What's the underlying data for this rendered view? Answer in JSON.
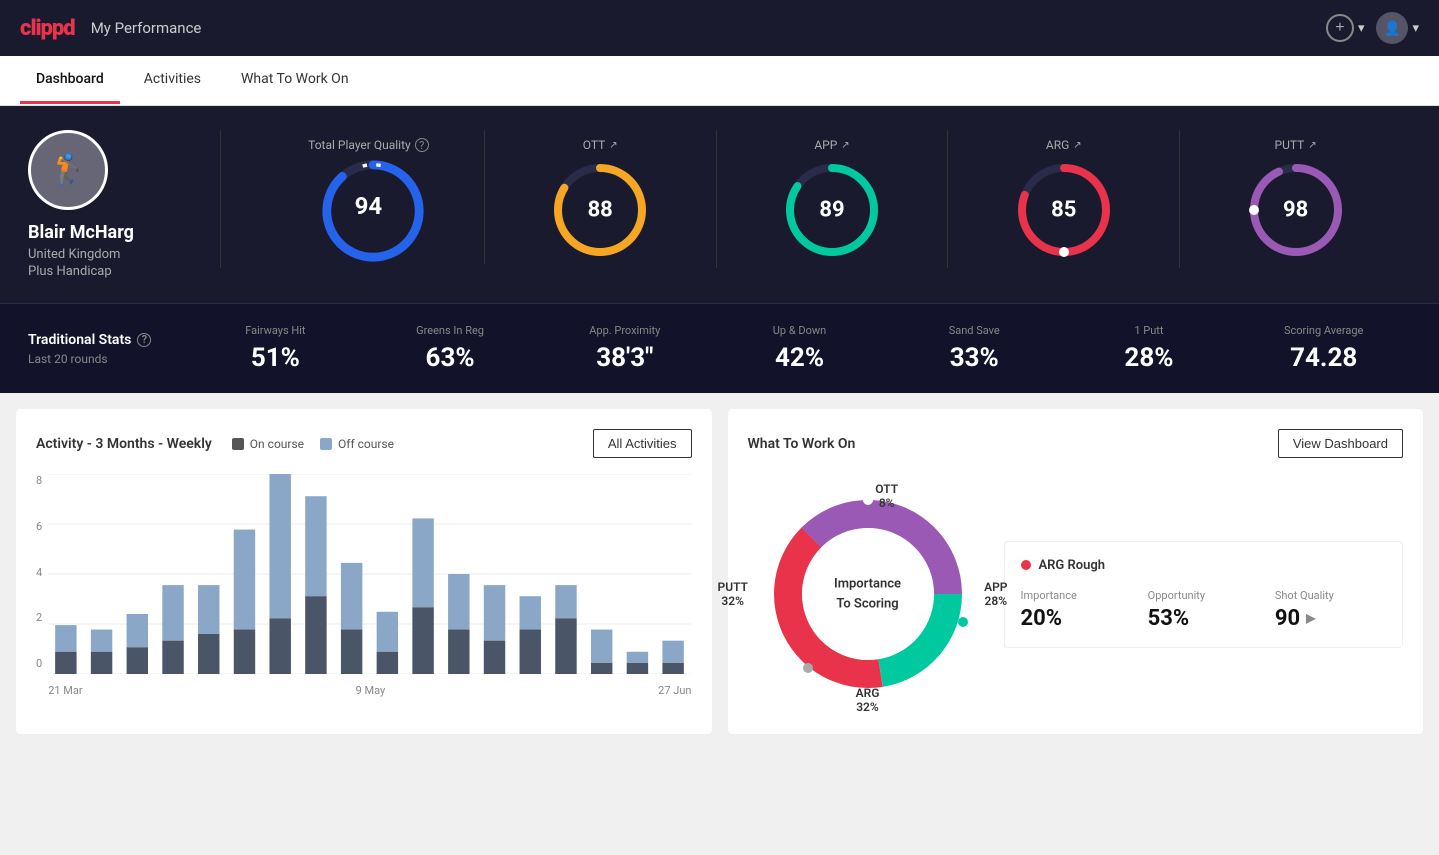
{
  "header": {
    "logo": "clippd",
    "title": "My Performance",
    "add_label": "+",
    "add_chevron": "▾",
    "avatar_text": "👤",
    "user_chevron": "▾"
  },
  "tabs": [
    {
      "id": "dashboard",
      "label": "Dashboard",
      "active": true
    },
    {
      "id": "activities",
      "label": "Activities",
      "active": false
    },
    {
      "id": "what-to-work-on",
      "label": "What To Work On",
      "active": false
    }
  ],
  "player": {
    "name": "Blair McHarg",
    "country": "United Kingdom",
    "handicap": "Plus Handicap"
  },
  "total_quality": {
    "label": "Total Player Quality",
    "value": "94",
    "color": "#2563eb"
  },
  "scores": [
    {
      "label": "OTT",
      "value": "88",
      "color": "#f5a623",
      "pct": 88
    },
    {
      "label": "APP",
      "value": "89",
      "color": "#00c9a0",
      "pct": 89
    },
    {
      "label": "ARG",
      "value": "85",
      "color": "#e8334a",
      "pct": 85
    },
    {
      "label": "PUTT",
      "value": "98",
      "color": "#9b59b6",
      "pct": 98
    }
  ],
  "traditional_stats": {
    "title": "Traditional Stats",
    "subtitle": "Last 20 rounds",
    "stats": [
      {
        "label": "Fairways Hit",
        "value": "51%"
      },
      {
        "label": "Greens In Reg",
        "value": "63%"
      },
      {
        "label": "App. Proximity",
        "value": "38'3\""
      },
      {
        "label": "Up & Down",
        "value": "42%"
      },
      {
        "label": "Sand Save",
        "value": "33%"
      },
      {
        "label": "1 Putt",
        "value": "28%"
      },
      {
        "label": "Scoring Average",
        "value": "74.28"
      }
    ]
  },
  "activity_chart": {
    "title": "Activity - 3 Months - Weekly",
    "legend": [
      {
        "label": "On course",
        "color": "#555"
      },
      {
        "label": "Off course",
        "color": "#8ba7c7"
      }
    ],
    "all_activities_btn": "All Activities",
    "x_labels": [
      "21 Mar",
      "9 May",
      "27 Jun"
    ],
    "bars": [
      {
        "on": 1,
        "off": 1.2
      },
      {
        "on": 1,
        "off": 1.0
      },
      {
        "on": 1.2,
        "off": 1.5
      },
      {
        "on": 1.5,
        "off": 2.5
      },
      {
        "on": 1.8,
        "off": 2.2
      },
      {
        "on": 2,
        "off": 4.5
      },
      {
        "on": 2.5,
        "off": 6.5
      },
      {
        "on": 3.5,
        "off": 4.5
      },
      {
        "on": 2,
        "off": 3.0
      },
      {
        "on": 1,
        "off": 1.8
      },
      {
        "on": 3,
        "off": 4.0
      },
      {
        "on": 2,
        "off": 2.5
      },
      {
        "on": 1.5,
        "off": 2.5
      },
      {
        "on": 2,
        "off": 1.5
      },
      {
        "on": 2.5,
        "off": 1.5
      },
      {
        "on": 0.5,
        "off": 1.5
      },
      {
        "on": 0.5,
        "off": 0.5
      },
      {
        "on": 0.5,
        "off": 1.0
      }
    ],
    "y_labels": [
      "0",
      "2",
      "4",
      "6",
      "8"
    ],
    "max_value": 9
  },
  "what_to_work_on": {
    "title": "What To Work On",
    "view_dashboard_btn": "View Dashboard",
    "donut_label": "Importance\nTo Scoring",
    "segments": [
      {
        "label": "OTT\n8%",
        "value": 8,
        "color": "#f5a623"
      },
      {
        "label": "APP\n28%",
        "value": 28,
        "color": "#00c9a0"
      },
      {
        "label": "ARG\n32%",
        "value": 32,
        "color": "#e8334a"
      },
      {
        "label": "PUTT\n32%",
        "value": 32,
        "color": "#9b59b6"
      }
    ],
    "recommendation": {
      "title": "ARG Rough",
      "color": "#e8334a",
      "stats": [
        {
          "label": "Importance",
          "value": "20%"
        },
        {
          "label": "Opportunity",
          "value": "53%"
        },
        {
          "label": "Shot Quality",
          "value": "90",
          "has_arrow": true
        }
      ]
    }
  }
}
